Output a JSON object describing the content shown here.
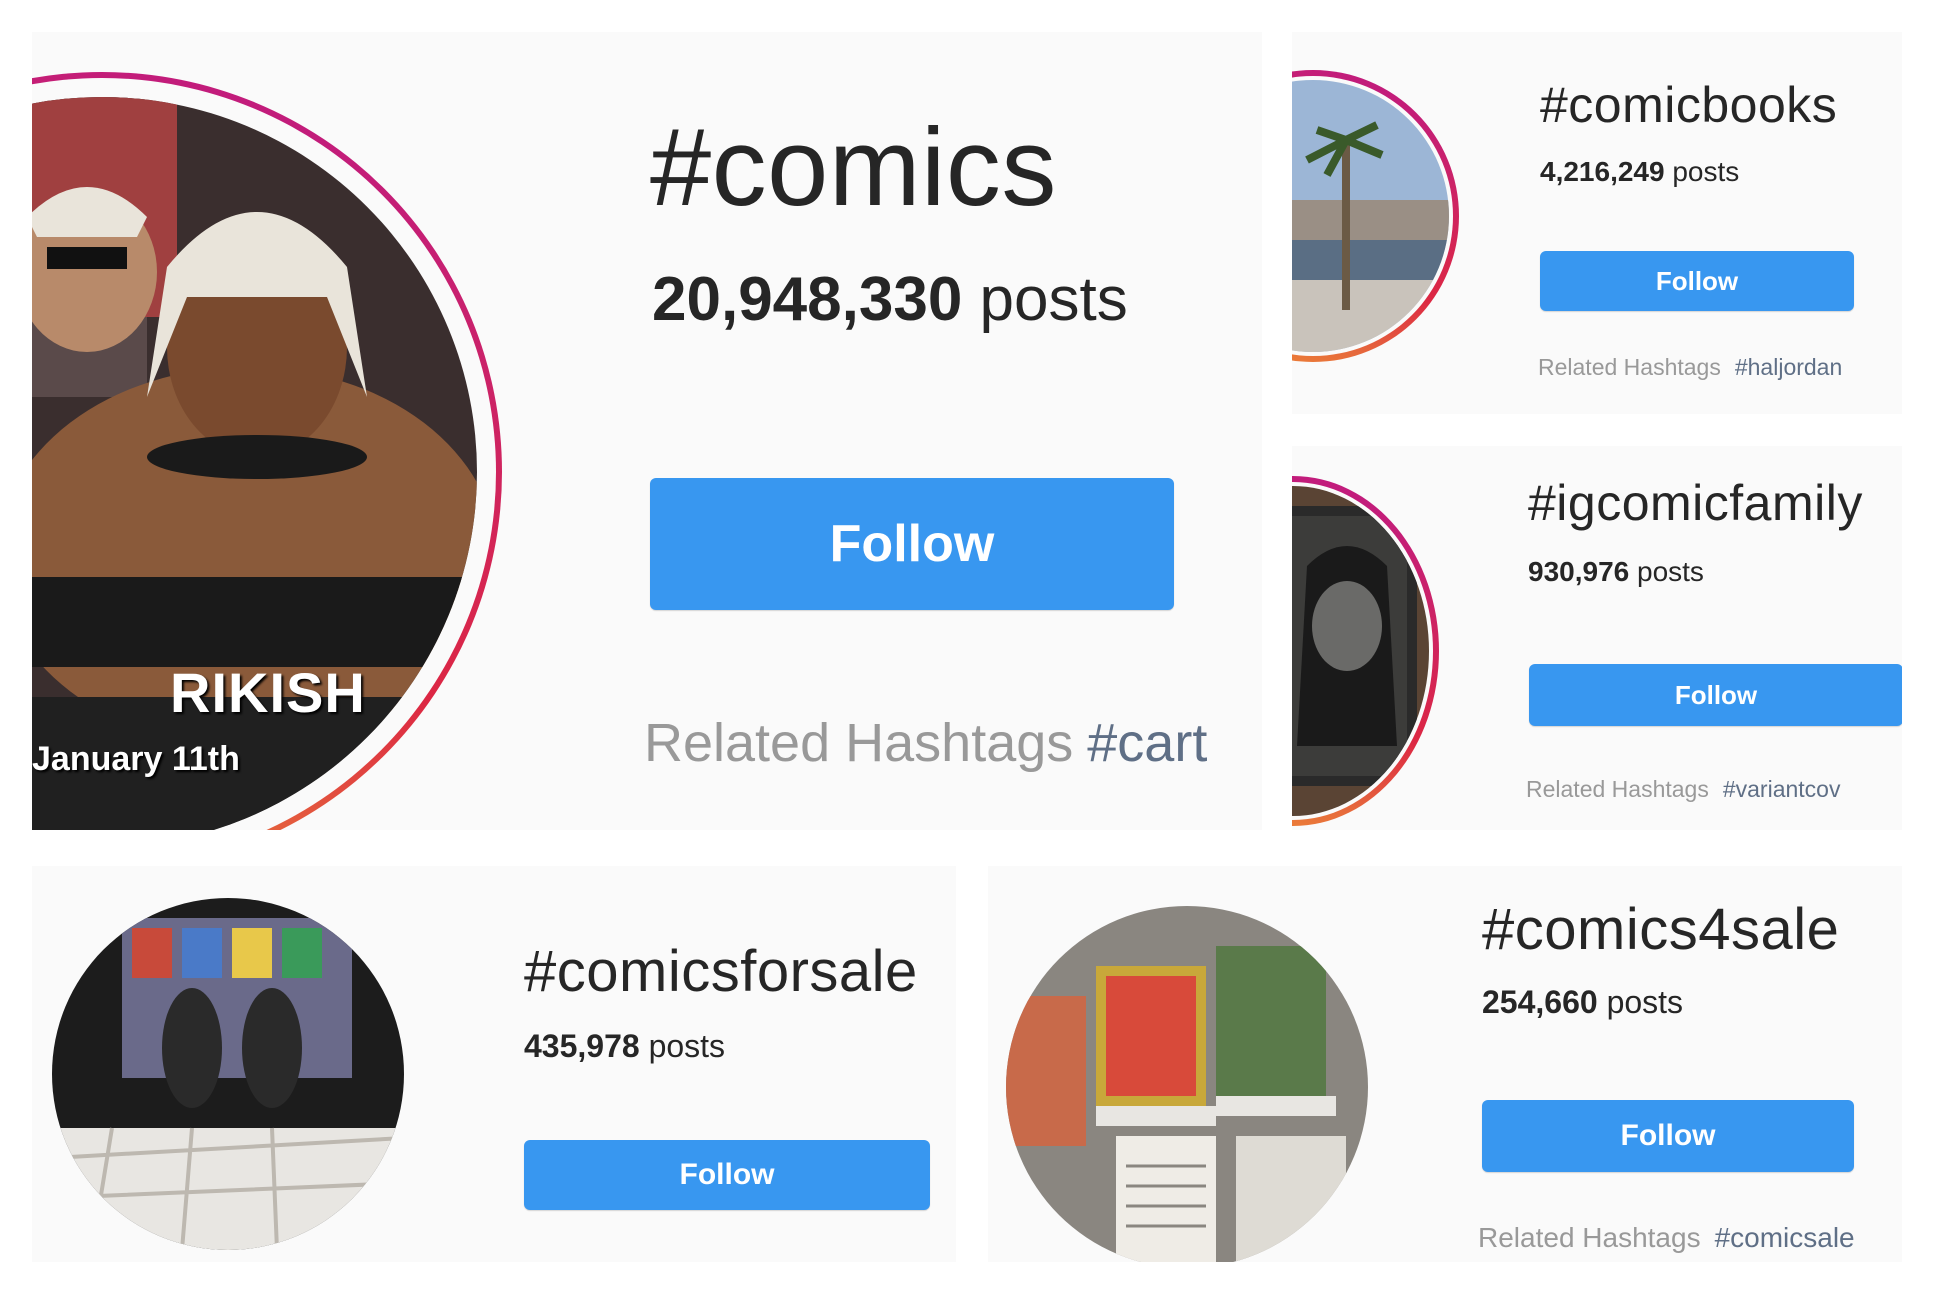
{
  "panels": {
    "comics": {
      "hashtag": "#comics",
      "count": "20,948,330",
      "count_unit": "posts",
      "follow_label": "Follow",
      "related_label": "Related Hashtags",
      "related_tag": "#cart",
      "photo_caption_1": "RIKISH",
      "photo_caption_2": "January 11th"
    },
    "comicbooks": {
      "hashtag": "#comicbooks",
      "count": "4,216,249",
      "count_unit": "posts",
      "follow_label": "Follow",
      "related_label": "Related Hashtags",
      "related_tag": "#haljordan"
    },
    "igcomicfamily": {
      "hashtag": "#igcomicfamily",
      "count": "930,976",
      "count_unit": "posts",
      "follow_label": "Follow",
      "related_label": "Related Hashtags",
      "related_tag": "#variantcov"
    },
    "comicsforsale": {
      "hashtag": "#comicsforsale",
      "count": "435,978",
      "count_unit": "posts",
      "follow_label": "Follow"
    },
    "comics4sale": {
      "hashtag": "#comics4sale",
      "count": "254,660",
      "count_unit": "posts",
      "follow_label": "Follow",
      "related_label": "Related Hashtags",
      "related_tag": "#comicsale"
    }
  },
  "colors": {
    "follow_button": "#3897f0",
    "story_ring_start": "#bc1888",
    "story_ring_end": "#f09433",
    "related_text": "#999999",
    "panel_bg": "#fafafa"
  }
}
